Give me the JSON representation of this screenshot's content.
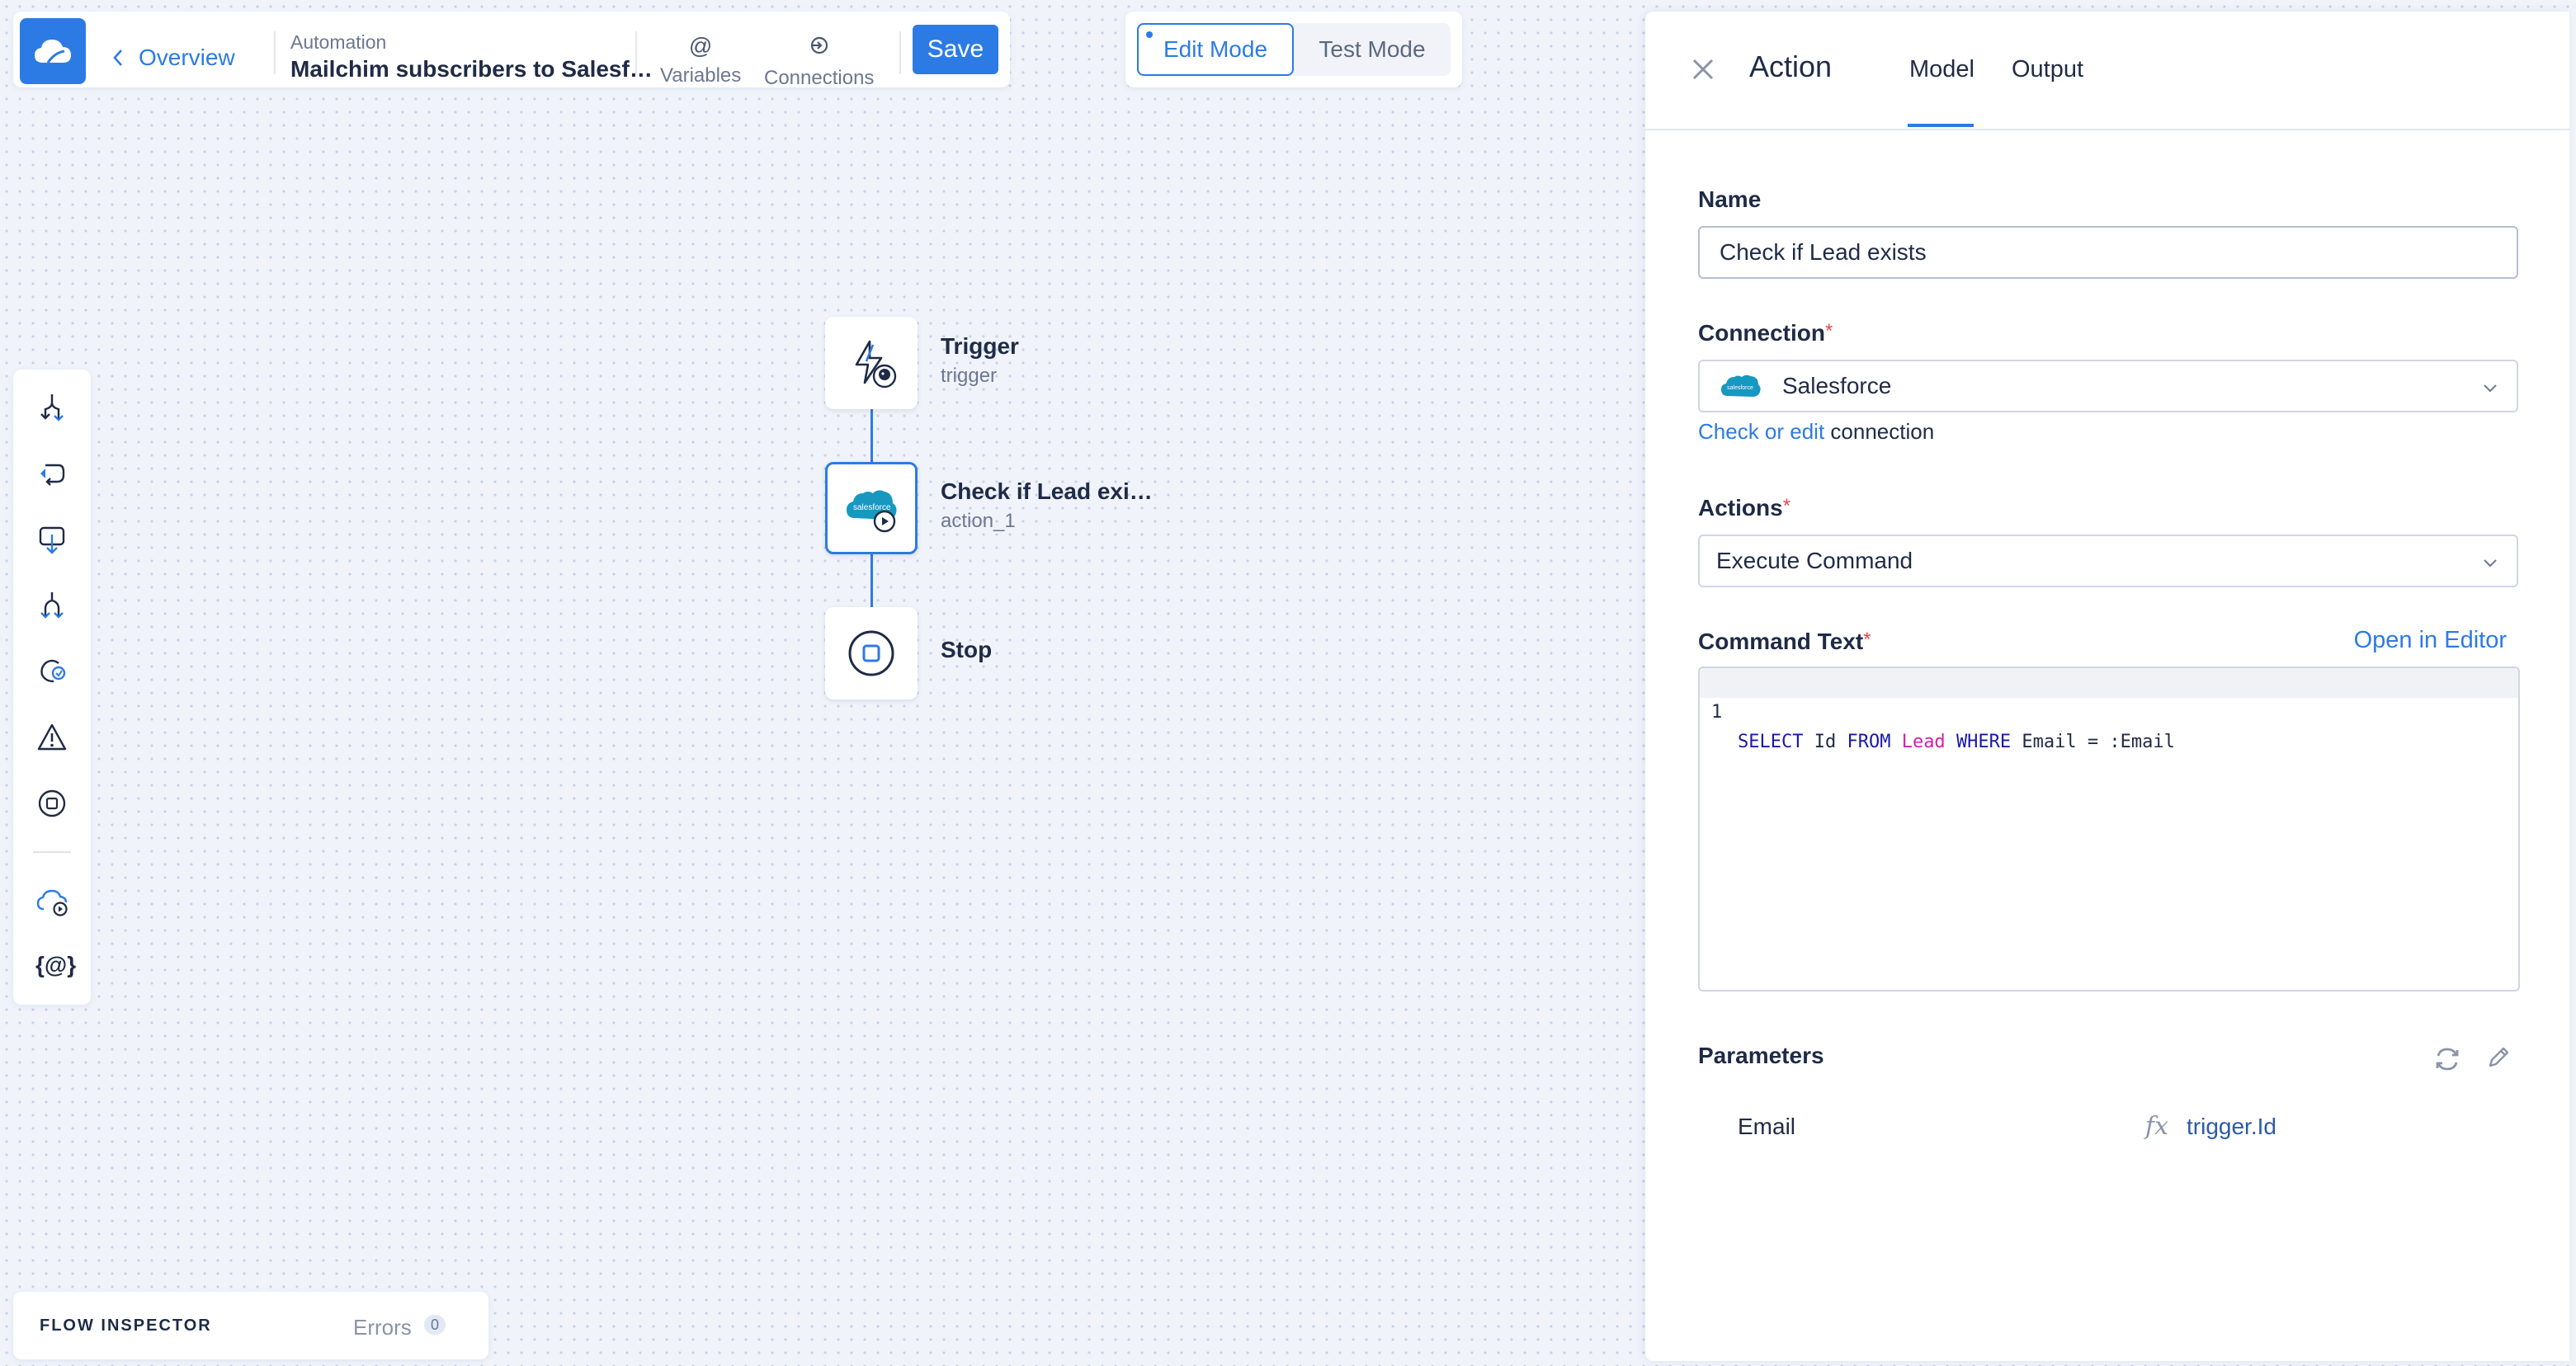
{
  "header": {
    "overview_label": "Overview",
    "automation_label": "Automation",
    "automation_title": "Mailchim subscribers to Salesf…",
    "variables_label": "Variables",
    "variables_icon": "@",
    "connections_label": "Connections",
    "save_label": "Save"
  },
  "modes": {
    "edit_label": "Edit Mode",
    "test_label": "Test Mode",
    "active": "Edit Mode"
  },
  "palette": {
    "tools": [
      "if-branch-icon",
      "loop-icon",
      "import-icon",
      "parallel-icon",
      "refresh-step-icon",
      "raise-error-icon",
      "stop-icon",
      "cloud-action-icon",
      "variables-icon"
    ],
    "variables_glyph": "{@}"
  },
  "flow": {
    "nodes": [
      {
        "title": "Trigger",
        "subtitle": "trigger",
        "icon": "trigger-bolt-icon"
      },
      {
        "title": "Check if Lead exi…",
        "subtitle": "action_1",
        "icon": "salesforce-icon"
      },
      {
        "title": "Stop",
        "subtitle": "",
        "icon": "stop-icon"
      }
    ]
  },
  "inspector": {
    "title": "FLOW INSPECTOR",
    "errors_label": "Errors",
    "errors_count": "0"
  },
  "panel": {
    "title": "Action",
    "tabs": [
      "Model",
      "Output"
    ],
    "active_tab": "Model",
    "name_label": "Name",
    "name_value": "Check if Lead exists",
    "connection_label": "Connection",
    "connection_value": "Salesforce",
    "check_link": "Check or edit",
    "check_suffix": " connection",
    "actions_label": "Actions",
    "actions_value": "Execute Command",
    "command_label": "Command Text",
    "open_editor": "Open in Editor",
    "code_line_number": "1",
    "code": {
      "kw_select": "SELECT",
      "id": " Id ",
      "kw_from": "FROM",
      "table": " Lead ",
      "kw_where": "WHERE",
      "rest": " Email = :Email"
    },
    "params_label": "Parameters",
    "params": [
      {
        "name": "Email",
        "fx": "fx",
        "value": "trigger.Id"
      }
    ]
  },
  "colors": {
    "accent": "#2c7be5",
    "background": "#f0f3fa",
    "required": "#e5484d",
    "sql_keyword": "#1a1aa6",
    "sql_table": "#d11fb4"
  }
}
